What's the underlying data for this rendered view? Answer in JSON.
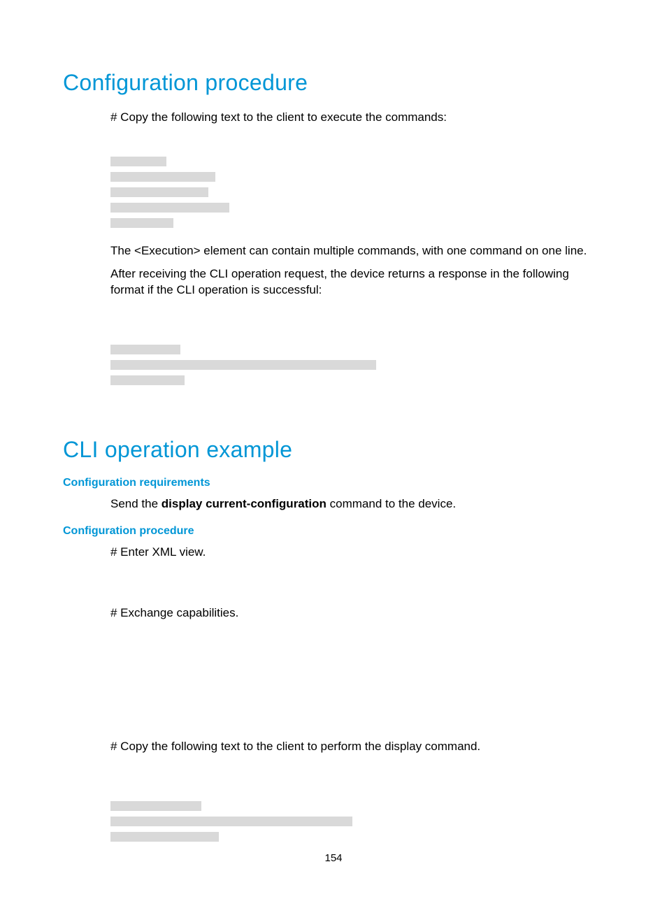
{
  "headings": {
    "config_procedure": "Configuration procedure",
    "cli_example": "CLI operation example",
    "config_requirements": "Configuration requirements",
    "config_procedure2": "Configuration procedure"
  },
  "paragraphs": {
    "copy_text1": "# Copy the following text to the client to execute the commands:",
    "execution_note": "The <Execution> element can contain multiple commands, with one command on one line.",
    "after_receiving": "After receiving the CLI operation request, the device returns a response in the following format if the CLI operation is successful:",
    "send_cmd_pre": "Send the ",
    "send_cmd_bold": "display current-configuration",
    "send_cmd_post": " command to the device.",
    "enter_xml": "# Enter XML view.",
    "exchange_caps": "# Exchange capabilities.",
    "copy_text2": "# Copy the following text to the client to perform the display command."
  },
  "code_blocks": {
    "block1": [
      80,
      150,
      140,
      170,
      90
    ],
    "block2": [
      100,
      380,
      106
    ],
    "block3": [
      105,
      110
    ],
    "block4": [
      110
    ],
    "block5": [
      130,
      346,
      155
    ]
  },
  "hidden_code_rows": {
    "block1_pre": 1,
    "block2_pre": 2,
    "block3_pre": 0,
    "block4_post": 5,
    "block5_pre": 2
  },
  "page_number": "154"
}
